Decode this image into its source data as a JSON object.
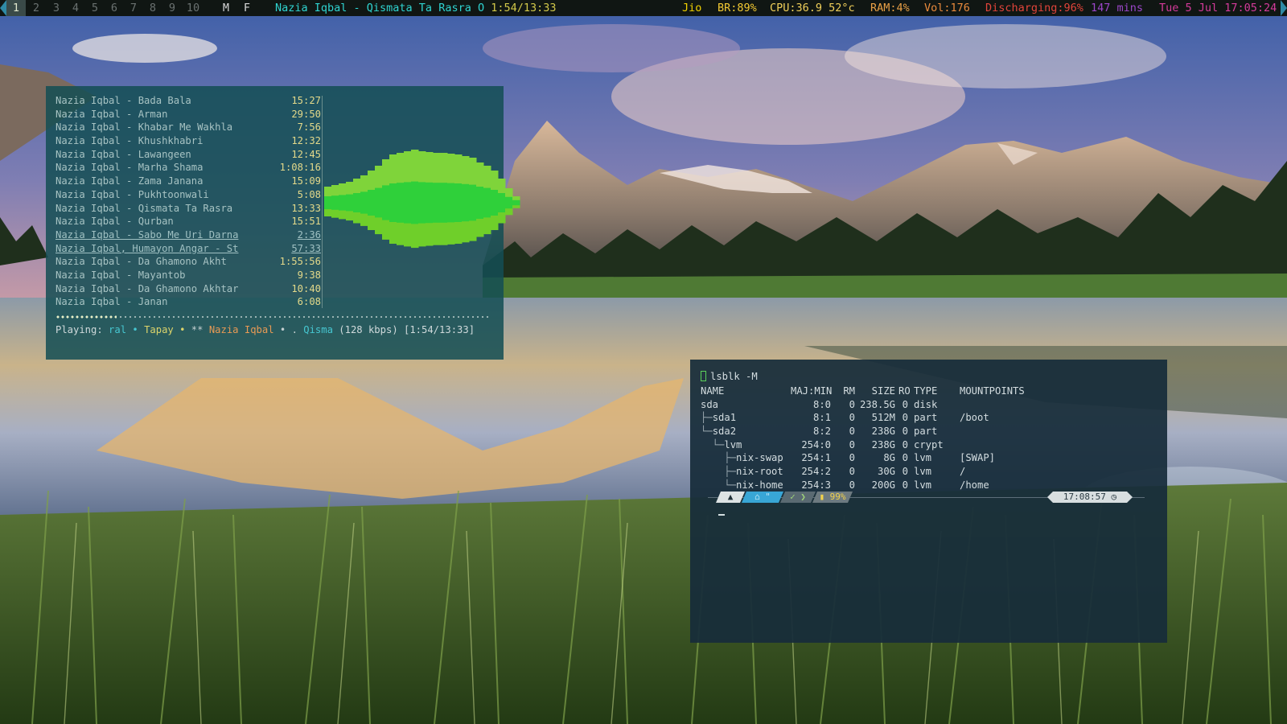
{
  "topbar": {
    "workspaces": [
      "1",
      "2",
      "3",
      "4",
      "5",
      "6",
      "7",
      "8",
      "9",
      "10"
    ],
    "active_workspace": "1",
    "mode_flags": [
      "M",
      "F"
    ],
    "window_title": "Nazia Iqbal - Qismata Ta Rasra",
    "window_title_sep": "O",
    "playback_time": "1:54/13:33",
    "network": "Jio",
    "brightness": "BR:89%",
    "cpu": "CPU:36.9 52°c",
    "ram": "RAM:4%",
    "volume": "Vol:176",
    "battery": "Discharging:96%",
    "battery_remaining": "147 mins",
    "clock": "Tue 5 Jul 17:05:24",
    "colors": {
      "network": "#f0d000",
      "brightness": "#f2c933",
      "cpu": "#f0cf5a",
      "ram": "#e8a046",
      "volume": "#e88a3c",
      "battery": "#e0443a",
      "remaining": "#9b46c9",
      "clock": "#d43b9a"
    }
  },
  "music": {
    "playlist": [
      {
        "title": "Nazia Iqbal - Bada Bala",
        "duration": "15:27",
        "marked": false
      },
      {
        "title": "Nazia Iqbal - Arman",
        "duration": "29:50",
        "marked": false
      },
      {
        "title": "Nazia Iqbal - Khabar Me Wakhla",
        "duration": "7:56",
        "marked": false
      },
      {
        "title": "Nazia Iqbal - Khushkhabri",
        "duration": "12:32",
        "marked": false
      },
      {
        "title": "Nazia Iqbal - Lawangeen",
        "duration": "12:45",
        "marked": false
      },
      {
        "title": "Nazia Iqbal - Marha Shama",
        "duration": "1:08:16",
        "marked": false
      },
      {
        "title": "Nazia Iqbal - Zama Janana",
        "duration": "15:09",
        "marked": false
      },
      {
        "title": "Nazia Iqbal - Pukhtoonwali",
        "duration": "5:08",
        "marked": false
      },
      {
        "title": "Nazia Iqbal - Qismata Ta Rasra",
        "duration": "13:33",
        "marked": false
      },
      {
        "title": "Nazia Iqbal - Qurban",
        "duration": "15:51",
        "marked": false
      },
      {
        "title": "Nazia Iqbal - Sabo Me Uri Darna",
        "duration": "2:36",
        "marked": true
      },
      {
        "title": "Nazia Iqbal, Humayon Angar - St",
        "duration": "57:33",
        "marked": true
      },
      {
        "title": "Nazia Iqbal - Da Ghamono Akht",
        "duration": "1:55:56",
        "marked": false
      },
      {
        "title": "Nazia Iqbal - Mayantob",
        "duration": "9:38",
        "marked": false
      },
      {
        "title": "Nazia Iqbal - Da Ghamono Akhtar",
        "duration": "10:40",
        "marked": false
      },
      {
        "title": "Nazia Iqbal - Janan",
        "duration": "6:08",
        "marked": false
      }
    ],
    "progress_fraction": 0.14,
    "status": {
      "label": "Playing:",
      "scroll_a": "ral •",
      "scroll_b": "Tapay •",
      "stars": "**",
      "artist": "Nazia Iqbal",
      "bullet": "• .",
      "track": "Qisma",
      "bitrate": "(128 kbps)",
      "time": "[1:54/13:33]"
    }
  },
  "terminal": {
    "command": "lsblk -M",
    "columns": {
      "name": "NAME",
      "majmin": "MAJ:MIN",
      "rm": "RM",
      "size": "SIZE",
      "ro": "RO",
      "type": "TYPE",
      "mount": "MOUNTPOINTS"
    },
    "rows": [
      {
        "tree": "",
        "name": "sda",
        "majmin": "8:0",
        "rm": "0",
        "size": "238.5G",
        "ro": "0",
        "type": "disk",
        "mount": ""
      },
      {
        "tree": "├─",
        "name": "sda1",
        "majmin": "8:1",
        "rm": "0",
        "size": "512M",
        "ro": "0",
        "type": "part",
        "mount": "/boot"
      },
      {
        "tree": "└─",
        "name": "sda2",
        "majmin": "8:2",
        "rm": "0",
        "size": "238G",
        "ro": "0",
        "type": "part",
        "mount": ""
      },
      {
        "tree": "  └─",
        "name": "lvm",
        "majmin": "254:0",
        "rm": "0",
        "size": "238G",
        "ro": "0",
        "type": "crypt",
        "mount": ""
      },
      {
        "tree": "    ├─",
        "name": "nix-swap",
        "majmin": "254:1",
        "rm": "0",
        "size": "8G",
        "ro": "0",
        "type": "lvm",
        "mount": "[SWAP]"
      },
      {
        "tree": "    ├─",
        "name": "nix-root",
        "majmin": "254:2",
        "rm": "0",
        "size": "30G",
        "ro": "0",
        "type": "lvm",
        "mount": "/"
      },
      {
        "tree": "    └─",
        "name": "nix-home",
        "majmin": "254:3",
        "rm": "0",
        "size": "200G",
        "ro": "0",
        "type": "lvm",
        "mount": "/home"
      }
    ],
    "prompt": {
      "os_icon": "▲",
      "dir": "⌂ \"",
      "ok": "✓ ❯",
      "battery": "▮ 99%",
      "clock": "17:08:57 ◷"
    }
  }
}
